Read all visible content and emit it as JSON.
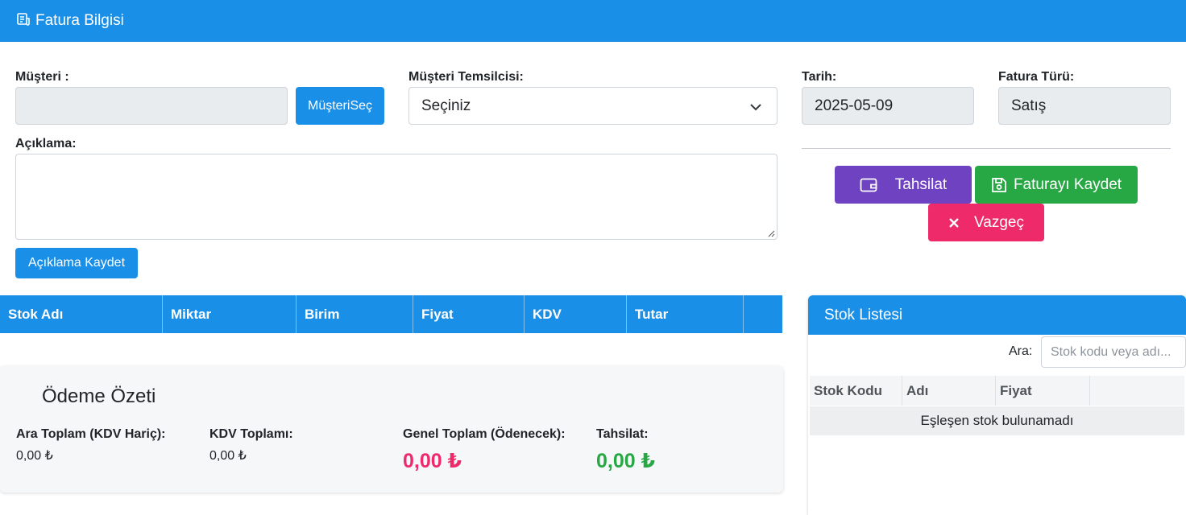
{
  "header": {
    "title": "Fatura Bilgisi",
    "icon": "receipt-icon"
  },
  "form": {
    "customer_label": "Müşteri :",
    "customer_value": "",
    "customer_select_button": "MüşteriSeç",
    "rep_label": "Müşteri Temsilcisi:",
    "rep_selected": "Seçiniz",
    "date_label": "Tarih:",
    "date_value": "2025-05-09",
    "type_label": "Fatura Türü:",
    "type_value": "Satış",
    "desc_label": "Açıklama:",
    "desc_value": "",
    "desc_save_button": "Açıklama Kaydet"
  },
  "actions": {
    "collection": {
      "label": "Tahsilat",
      "color": "#6f42c1",
      "icon": "wallet-icon"
    },
    "save": {
      "label": "Faturayı Kaydet",
      "color": "#28a745",
      "icon": "floppy-disk-icon"
    },
    "cancel": {
      "label": "Vazgeç",
      "color": "#ee2a6b",
      "icon": "close-icon"
    }
  },
  "invoice_table": {
    "columns": [
      "Stok Adı",
      "Miktar",
      "Birim",
      "Fiyat",
      "KDV",
      "Tutar",
      ""
    ],
    "rows": []
  },
  "summary": {
    "title": "Ödeme Özeti",
    "icon": "calculator-icon",
    "subtotal_label": "Ara Toplam (KDV Hariç):",
    "subtotal_value": "0,00 ₺",
    "vat_label": "KDV Toplamı:",
    "vat_value": "0,00 ₺",
    "grand_label": "Genel Toplam (Ödenecek):",
    "grand_value": "0,00 ₺",
    "grand_color": "#ee2a6b",
    "collection_label": "Tahsilat:",
    "collection_value": "0,00 ₺",
    "collection_color": "#28a745"
  },
  "stock_panel": {
    "title": "Stok Listesi",
    "search_label": "Ara:",
    "search_placeholder": "Stok kodu veya adı...",
    "columns": [
      "Stok Kodu",
      "Adı",
      "Fiyat",
      ""
    ],
    "empty_message": "Eşleşen stok bulunamadı"
  },
  "colors": {
    "primary": "#1a8fe8"
  }
}
